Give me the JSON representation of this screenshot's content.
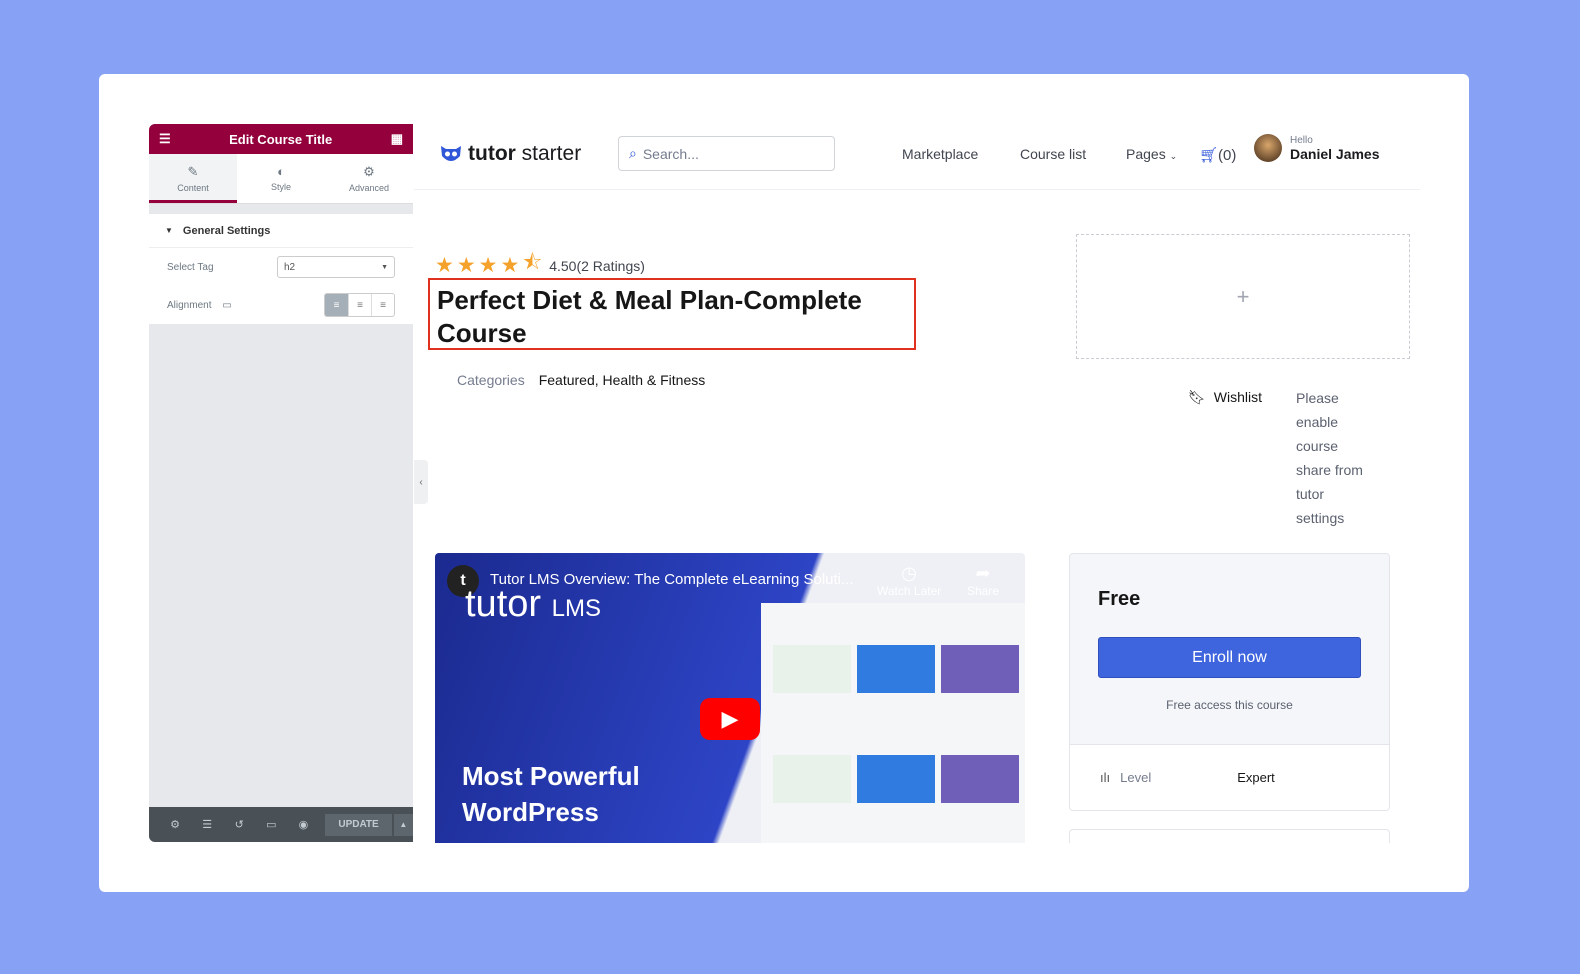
{
  "editor": {
    "title": "Edit Course Title",
    "tabs": [
      "Content",
      "Style",
      "Advanced"
    ],
    "section": "General Settings",
    "select_tag_label": "Select Tag",
    "select_tag_value": "h2",
    "alignment_label": "Alignment",
    "alignment_selected": "left",
    "update_label": "UPDATE",
    "accent": "#93003c"
  },
  "site": {
    "brand_bold": "tutor",
    "brand_light": "starter",
    "search_placeholder": "Search...",
    "nav": [
      "Marketplace",
      "Course list",
      "Pages"
    ],
    "cart": "(0)",
    "hello": "Hello",
    "user": "Daniel James"
  },
  "course": {
    "rating": 4.5,
    "rating_text": "4.50(2 Ratings)",
    "title": "Perfect Diet & Meal Plan-Complete Course",
    "categories_label": "Categories",
    "categories": "Featured, Health & Fitness",
    "placeholder_plus": "+",
    "wishlist": "Wishlist",
    "share_note": "Please enable course share from tutor settings"
  },
  "video": {
    "title": "Tutor LMS Overview: The Complete eLearning Soluti...",
    "brand": "tutor",
    "brand_suffix": "LMS",
    "headline": "Most Powerful WordPress",
    "watch_later": "Watch Later",
    "share": "Share"
  },
  "pricing": {
    "price": "Free",
    "enroll": "Enroll now",
    "note": "Free access this course",
    "level_label": "Level",
    "level_value": "Expert",
    "button_color": "#3e64de"
  }
}
